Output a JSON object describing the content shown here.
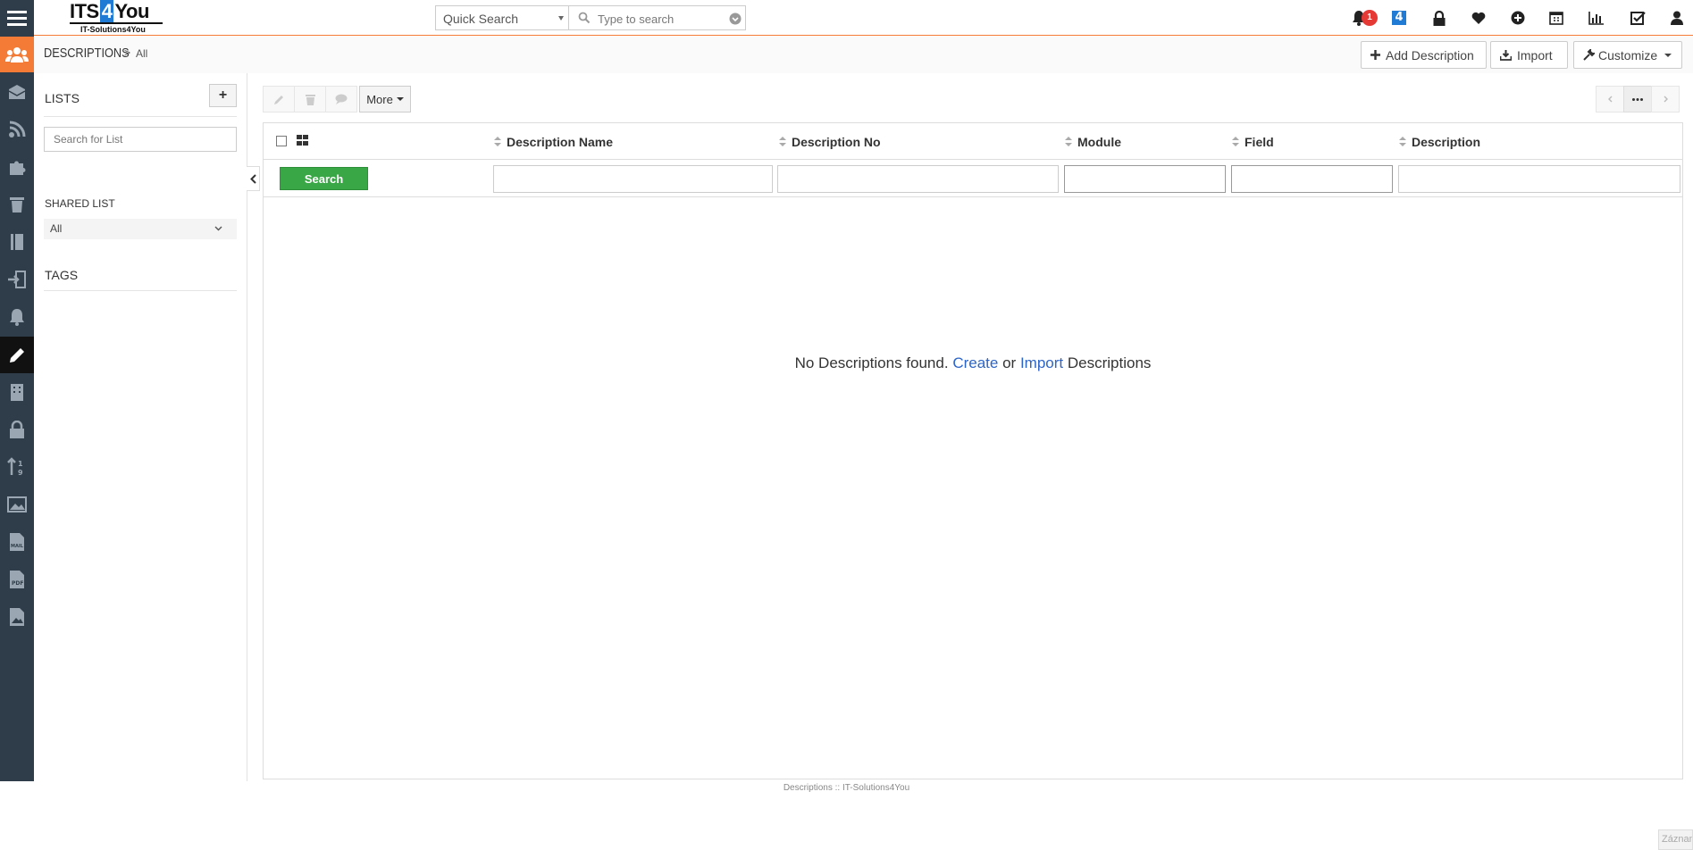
{
  "app": {
    "logo_main_pre": "ITS",
    "logo_main_num": "4",
    "logo_main_post": "You",
    "logo_sub": "IT-Solutions4You"
  },
  "topbar": {
    "quick_search_select": "Quick Search",
    "search_placeholder": "Type to search",
    "notification_count": "1",
    "icons": [
      "bell-icon",
      "its4you-icon",
      "lock-icon",
      "heart-icon",
      "plus-circle-icon",
      "calendar-icon",
      "bar-chart-icon",
      "checkbox-icon",
      "user-icon"
    ]
  },
  "breadcrumb": {
    "module": "DESCRIPTIONS",
    "separator": ">",
    "current": "All"
  },
  "header_actions": {
    "add_label": "Add Description",
    "import_label": "Import",
    "customize_label": "Customize"
  },
  "sidebar": {
    "lists_title": "LISTS",
    "add_list_label": "+",
    "search_placeholder": "Search for List",
    "shared_title": "SHARED LIST",
    "shared_value": "All",
    "tags_title": "TAGS"
  },
  "rail_icons": [
    "menu-icon",
    "users-icon",
    "inbox-icon",
    "rss-icon",
    "puzzle-icon",
    "trash-icon",
    "book-icon",
    "sign-in-icon",
    "bell-icon",
    "pencil-icon",
    "building-icon",
    "lock-icon",
    "sort-icon",
    "image-icon",
    "mail-doc-icon",
    "pdf-doc-icon",
    "picture-doc-icon"
  ],
  "toolbar": {
    "more_label": "More"
  },
  "table": {
    "columns": [
      "Description Name",
      "Description No",
      "Module",
      "Field",
      "Description"
    ],
    "search_label": "Search"
  },
  "empty_state": {
    "prefix": "No Descriptions found.",
    "create_link": "Create",
    "or": "or",
    "import_link": "Import",
    "suffix": "Descriptions"
  },
  "footer": {
    "text": "Descriptions :: IT-Solutions4You"
  },
  "corner": {
    "text": "Záznam"
  },
  "colors": {
    "rail_bg": "#2f3d4a",
    "accent_orange": "#f47b36",
    "search_green": "#3aa746",
    "link_blue": "#2c64c7",
    "badge_red": "#e53935"
  }
}
